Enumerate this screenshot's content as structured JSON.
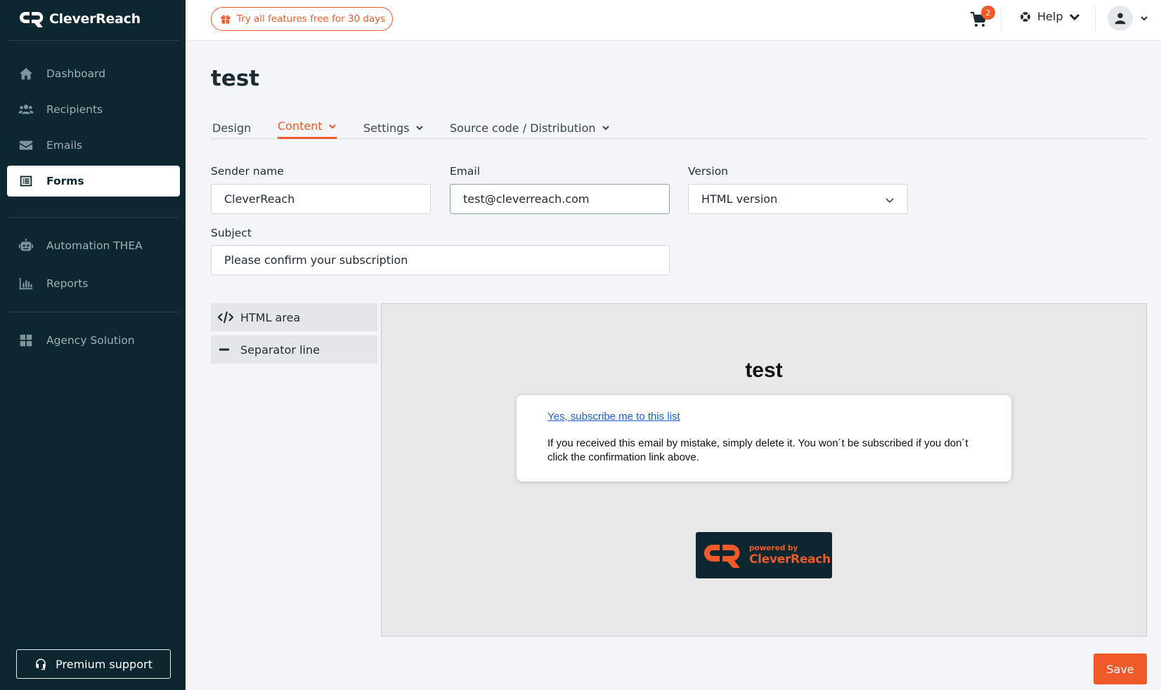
{
  "brand": {
    "name": "CleverReach",
    "accent": "#f05a28",
    "sidebar_bg": "#0d2730"
  },
  "sidebar": {
    "items": [
      {
        "label": "Dashboard",
        "icon": "home-icon"
      },
      {
        "label": "Recipients",
        "icon": "users-icon"
      },
      {
        "label": "Emails",
        "icon": "envelope-icon"
      },
      {
        "label": "Forms",
        "icon": "form-list-icon",
        "active": true
      },
      {
        "label": "Automation THEA",
        "icon": "robot-icon"
      },
      {
        "label": "Reports",
        "icon": "bar-chart-icon"
      },
      {
        "label": "Agency Solution",
        "icon": "grid-icon"
      }
    ],
    "premium_support": "Premium support"
  },
  "topbar": {
    "trial_label": "Try all features free for 30 days",
    "cart_count": "2",
    "help_label": "Help"
  },
  "page": {
    "title": "test"
  },
  "tabs": [
    {
      "label": "Design"
    },
    {
      "label": "Content",
      "active": true
    },
    {
      "label": "Settings"
    },
    {
      "label": "Source code / Distribution"
    }
  ],
  "form": {
    "sender_name": {
      "label": "Sender name",
      "value": "CleverReach"
    },
    "email": {
      "label": "Email",
      "value": "test@cleverreach.com"
    },
    "version": {
      "label": "Version",
      "value": "HTML version"
    },
    "subject": {
      "label": "Subject",
      "value": "Please confirm your subscription"
    }
  },
  "blocks": [
    {
      "label": "HTML area",
      "icon": "code-icon"
    },
    {
      "label": "Separator line",
      "icon": "minus-icon"
    }
  ],
  "preview": {
    "title": "test",
    "confirm_link": "Yes, subscribe me to this list",
    "disclaimer": "If you received this email by mistake, simply delete it. You won´t be subscribed if you don´t click the confirmation link above.",
    "powered_small": "powered by",
    "powered_brand": "CleverReach"
  },
  "actions": {
    "save_label": "Save"
  }
}
